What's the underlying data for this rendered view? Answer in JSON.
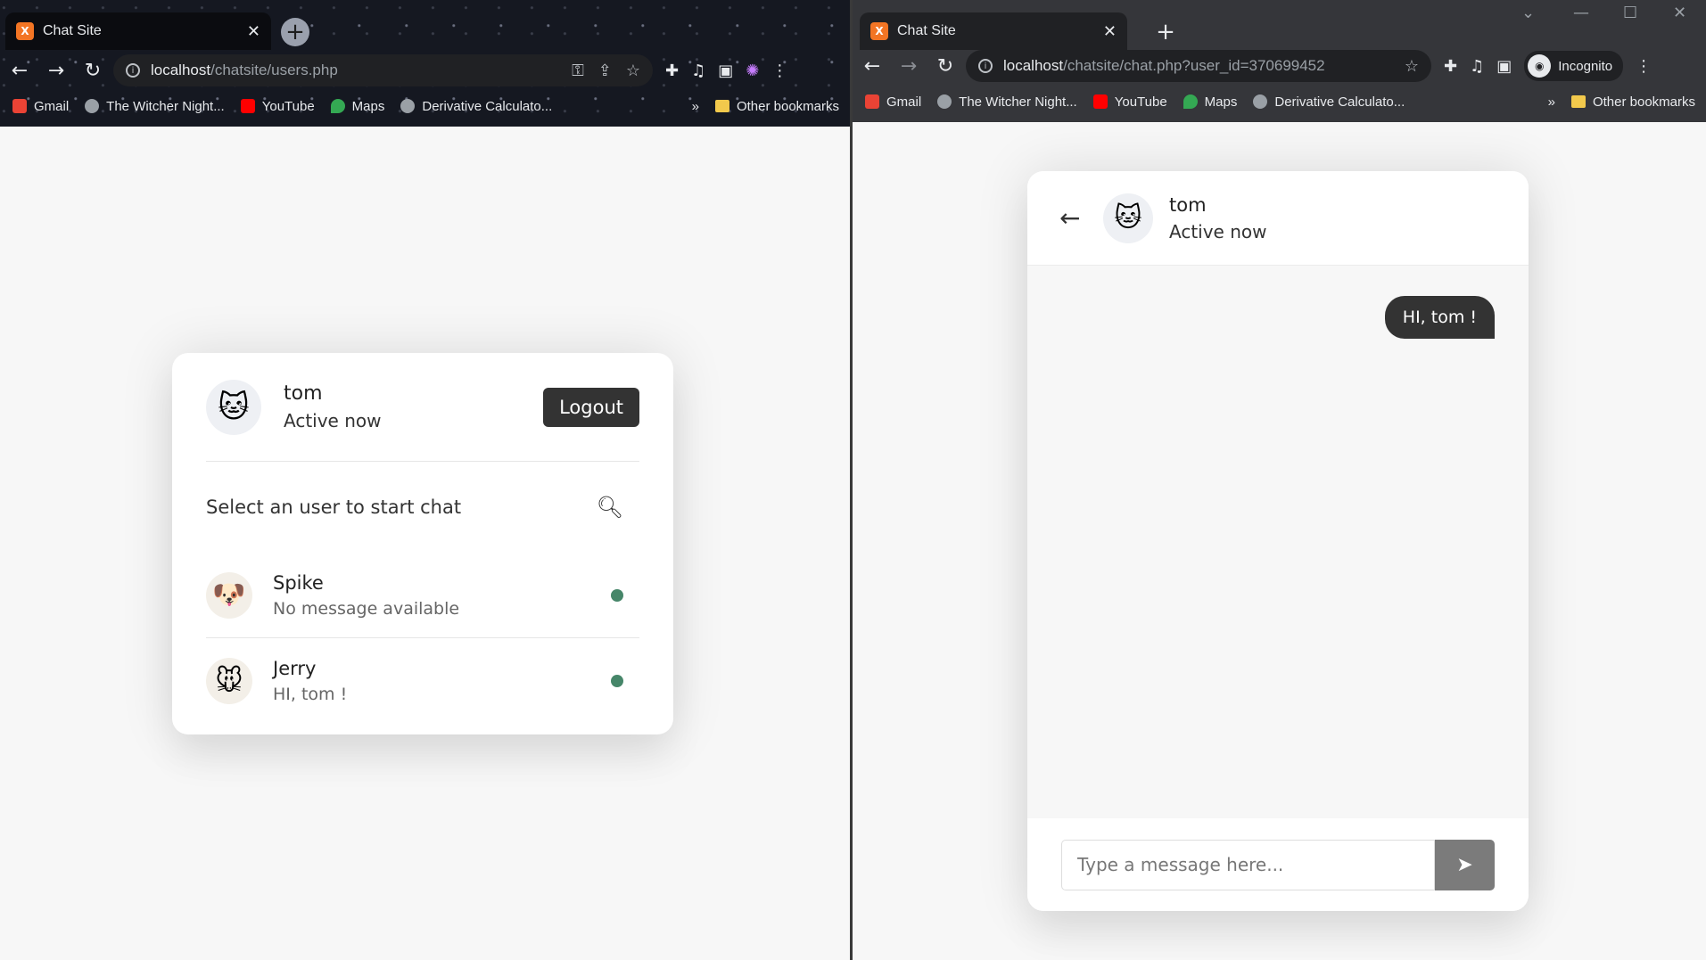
{
  "left_window": {
    "tab": {
      "title": "Chat Site",
      "favicon": "xampp-icon"
    },
    "url": {
      "host": "localhost",
      "path": "/chatsite/users.php"
    },
    "bookmarks": [
      {
        "label": "Gmail",
        "icon": "gmail-icon",
        "color": "#ea4335"
      },
      {
        "label": "The Witcher Night...",
        "icon": "globe-icon",
        "color": "#9aa0a6"
      },
      {
        "label": "YouTube",
        "icon": "youtube-icon",
        "color": "#ff0000"
      },
      {
        "label": "Maps",
        "icon": "maps-icon",
        "color": "#34a853"
      },
      {
        "label": "Derivative Calculato...",
        "icon": "calculator-icon",
        "color": "#9aa0a6"
      }
    ],
    "bookmarks_more": "»",
    "other_bookmarks": "Other bookmarks"
  },
  "right_window": {
    "tab": {
      "title": "Chat Site",
      "favicon": "xampp-icon"
    },
    "url": {
      "host": "localhost",
      "path": "/chatsite/chat.php?user_id=370699452"
    },
    "incognito_label": "Incognito",
    "bookmarks": [
      {
        "label": "Gmail",
        "icon": "gmail-icon",
        "color": "#ea4335"
      },
      {
        "label": "The Witcher Night...",
        "icon": "globe-icon",
        "color": "#9aa0a6"
      },
      {
        "label": "YouTube",
        "icon": "youtube-icon",
        "color": "#ff0000"
      },
      {
        "label": "Maps",
        "icon": "maps-icon",
        "color": "#34a853"
      },
      {
        "label": "Derivative Calculato...",
        "icon": "calculator-icon",
        "color": "#9aa0a6"
      }
    ],
    "bookmarks_more": "»",
    "other_bookmarks": "Other bookmarks"
  },
  "users_page": {
    "current_user": {
      "name": "tom",
      "status": "Active now",
      "avatar": "tom-avatar"
    },
    "logout_label": "Logout",
    "search_prompt": "Select an user to start chat",
    "users": [
      {
        "name": "Spike",
        "last_message": "No message available",
        "avatar": "spike-avatar",
        "online": true
      },
      {
        "name": "Jerry",
        "last_message": "HI, tom !",
        "avatar": "jerry-avatar",
        "online": true
      }
    ],
    "online_color": "#468669"
  },
  "chat_page": {
    "header": {
      "name": "tom",
      "status": "Active now",
      "avatar": "tom-avatar"
    },
    "messages": [
      {
        "direction": "outgoing",
        "text": "HI, tom !"
      }
    ],
    "input_placeholder": "Type a message here...",
    "send_icon": "paper-plane-icon"
  }
}
